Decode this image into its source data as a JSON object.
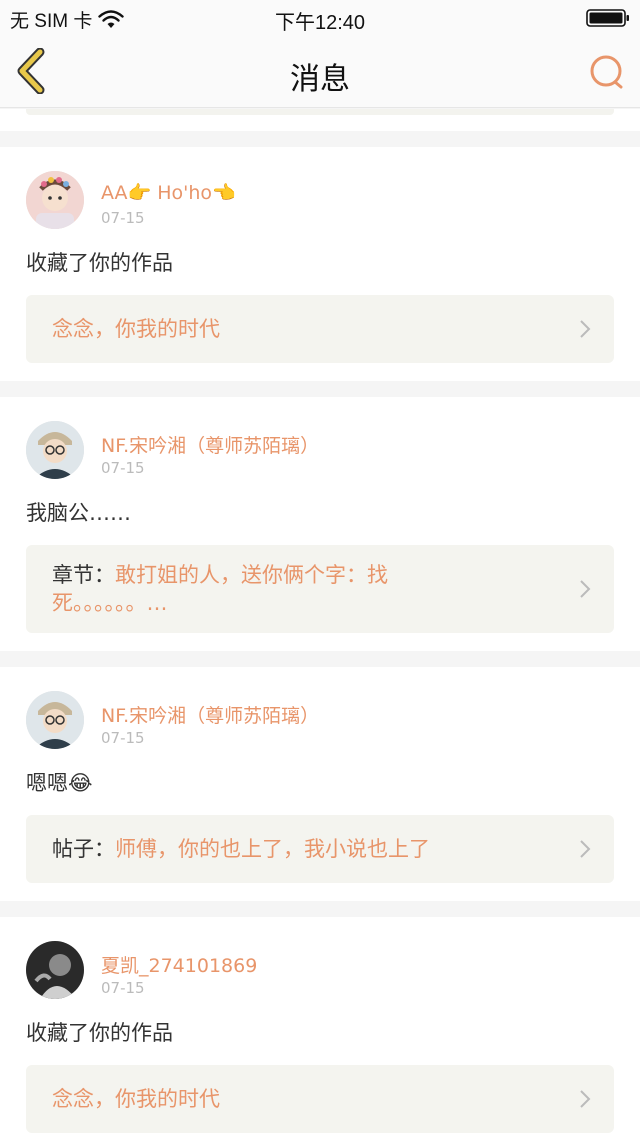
{
  "status_bar": {
    "carrier": "无 SIM 卡",
    "time": "下午12:40"
  },
  "nav": {
    "title": "消息",
    "back_icon": "chevron-left-icon",
    "search_icon": "search-icon"
  },
  "colors": {
    "accent": "#e8956a",
    "back_icon": "#e8c84a",
    "ref_bg": "#f4f4ef"
  },
  "messages": [
    {
      "user": "AA👉 Ho'ho👈",
      "date": "07-15",
      "text": "收藏了你的作品",
      "ref_prefix": "",
      "ref_text": "念念，你我的时代"
    },
    {
      "user": "NF.宋吟湘（尊师苏陌璃）",
      "date": "07-15",
      "text": "我脑公……",
      "ref_prefix": "章节：",
      "ref_text": "敢打姐的人，送你俩个字：找死。。。。。。…"
    },
    {
      "user": "NF.宋吟湘（尊师苏陌璃）",
      "date": "07-15",
      "text": "嗯嗯😂",
      "ref_prefix": "帖子：",
      "ref_text": "师傅，你的也上了，我小说也上了"
    },
    {
      "user": "夏凯_274101869",
      "date": "07-15",
      "text": "收藏了你的作品",
      "ref_prefix": "",
      "ref_text": "念念，你我的时代"
    }
  ]
}
